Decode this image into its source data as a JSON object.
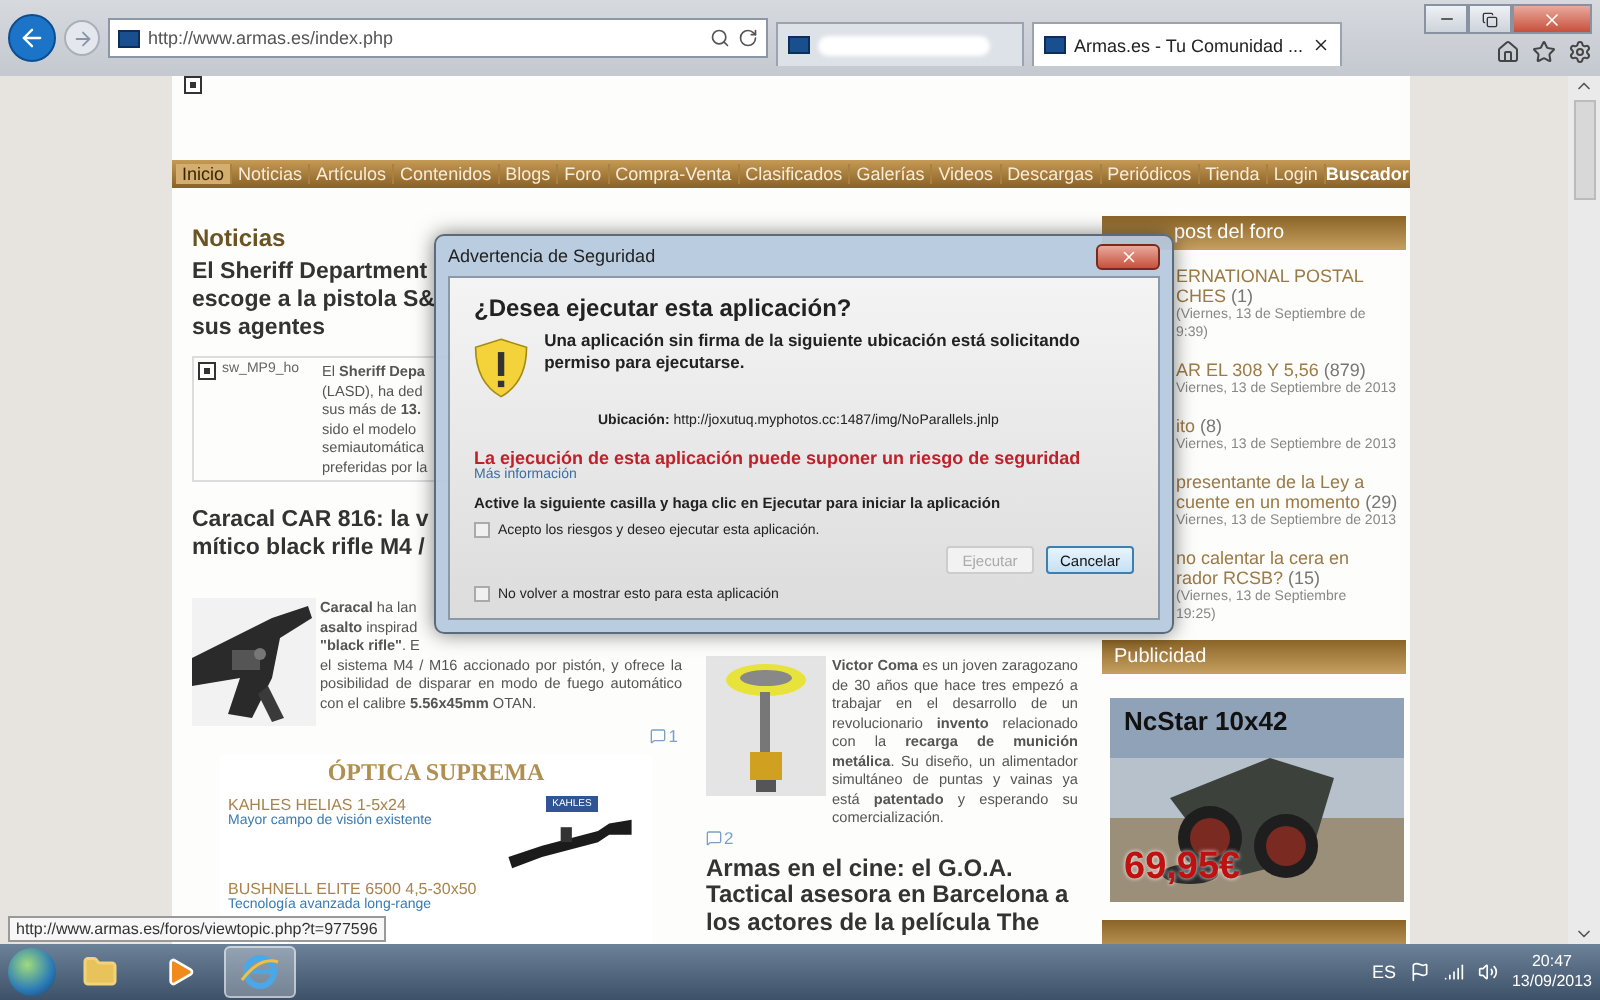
{
  "browser": {
    "address": "http://www.armas.es/index.php",
    "tabs": [
      {
        "selected": false
      },
      {
        "title": "Armas.es - Tu Comunidad ...",
        "selected": true
      }
    ]
  },
  "nav": {
    "items": [
      {
        "label": "Inicio",
        "selected": true
      },
      {
        "label": "Noticias",
        "selected": false
      },
      {
        "label": "Artículos",
        "selected": false
      },
      {
        "label": "Contenidos",
        "selected": false
      },
      {
        "label": "Blogs",
        "selected": false
      },
      {
        "label": "Foro",
        "selected": false
      },
      {
        "label": "Compra-Venta",
        "selected": false
      },
      {
        "label": "Clasificados",
        "selected": false
      },
      {
        "label": "Galerías",
        "selected": false
      },
      {
        "label": "Videos",
        "selected": false
      },
      {
        "label": "Descargas",
        "selected": false
      },
      {
        "label": "Periódicos",
        "selected": false
      },
      {
        "label": "Tienda",
        "selected": false
      },
      {
        "label": "Login",
        "selected": false
      }
    ],
    "search": "Buscador"
  },
  "news": {
    "heading": "Noticias",
    "article1": {
      "headline": [
        "El Sheriff Department",
        "escoge a la pistola S&",
        "sus agentes"
      ],
      "image_alt": "sw_MP9_ho",
      "lines": [
        "El **Sheriff Depa**",
        "(LASD), ha ded",
        "sus más de **13.**",
        "sido el modelo",
        "semiautomática",
        "preferidas por la"
      ]
    },
    "article2": {
      "headline": [
        "Caracal CAR 816: la v",
        "mítico black rifle M4 /"
      ],
      "lines": [
        "**Caracal** ha lan",
        "**asalto** inspirad",
        "**\"black rifle\"**. E"
      ],
      "text": "el sistema M4 / M16 accionado por pistón, y ofrece la posibilidad de disparar en modo de fuego automático con el calibre **5.56x45mm** OTAN.",
      "comments": "1"
    }
  },
  "banner": {
    "title": "ÓPTICA SUPREMA",
    "product1": "KAHLES HELIAS 1-5x24",
    "tagline1": "Mayor campo de visión existente",
    "brand": "KAHLES",
    "product2": "BUSHNELL ELITE 6500 4,5-30x50",
    "tagline2": "Tecnología avanzada long-range"
  },
  "articles": {
    "text": "**Victor Coma** es un joven zaragozano de 30 años que hace tres empezó a trabajar en el desarrollo de un revolucionario **invento** relacionado con la **recarga de munición metálica**. Su diseño, un alimentador simultáneo de puntas y vainas ya está **patentado** y esperando su comercialización.",
    "comments": "2",
    "headline": "Armas en el cine: el G.O.A. Tactical asesora en Barcelona a los actores de la película The"
  },
  "forum": {
    "heading": "post del foro",
    "posts": [
      {
        "title": [
          "ERNATIONAL POSTAL",
          "CHES"
        ],
        "count": "(1)",
        "meta": [
          "(Viernes, 13 de Septiembre de",
          "9:39)"
        ]
      },
      {
        "title": [
          "AR EL 308 Y 5,56"
        ],
        "count": "(879)",
        "meta": [
          "Viernes, 13 de Septiembre de 2013"
        ]
      },
      {
        "title": [
          "ito"
        ],
        "count": "(8)",
        "meta": [
          "Viernes, 13 de Septiembre de 2013"
        ]
      },
      {
        "title": [
          "presentante de la Ley a",
          "cuente en un momento"
        ],
        "count": "(29)",
        "meta": [
          "Viernes, 13 de Septiembre de 2013"
        ]
      },
      {
        "title": [
          "no calentar la cera en",
          "rador RCSB?"
        ],
        "count": "(15)",
        "meta": [
          "(Viernes, 13 de Septiembre",
          "19:25)"
        ]
      }
    ]
  },
  "ads": {
    "heading": "Publicidad",
    "product": "NcStar 10x42",
    "price": "69,95€"
  },
  "dialog": {
    "title": "Advertencia de Seguridad",
    "question": "¿Desea ejecutar esta aplicación?",
    "message": "Una aplicación sin firma de la siguiente ubicación está solicitando permiso para ejecutarse.",
    "location": "**Ubicación:** http://joxutuq.myphotos.cc:1487/img/NoParallels.jnlp",
    "warning": "La ejecución de esta aplicación puede suponer un riesgo de seguridad",
    "more_info": "Más información",
    "instruction": "Active la siguiente casilla y haga clic en Ejecutar para iniciar la aplicación",
    "accept": {
      "label": "Acepto los riesgos y deseo ejecutar esta aplicación.",
      "checked": false
    },
    "buttons": [
      {
        "label": "Ejecutar",
        "disabled": true
      },
      {
        "label": "Cancelar",
        "disabled": false
      }
    ],
    "dont_show": {
      "label": "No volver a mostrar esto para esta aplicación",
      "checked": false
    }
  },
  "status_tooltip": "http://www.armas.es/foros/viewtopic.php?t=977596",
  "taskbar": {
    "apps": [
      {
        "kind": "folder",
        "selected": false
      },
      {
        "kind": "media",
        "selected": false
      },
      {
        "kind": "browser",
        "selected": true
      }
    ],
    "language": "ES",
    "time": "20:47",
    "date": "13/09/2013"
  }
}
